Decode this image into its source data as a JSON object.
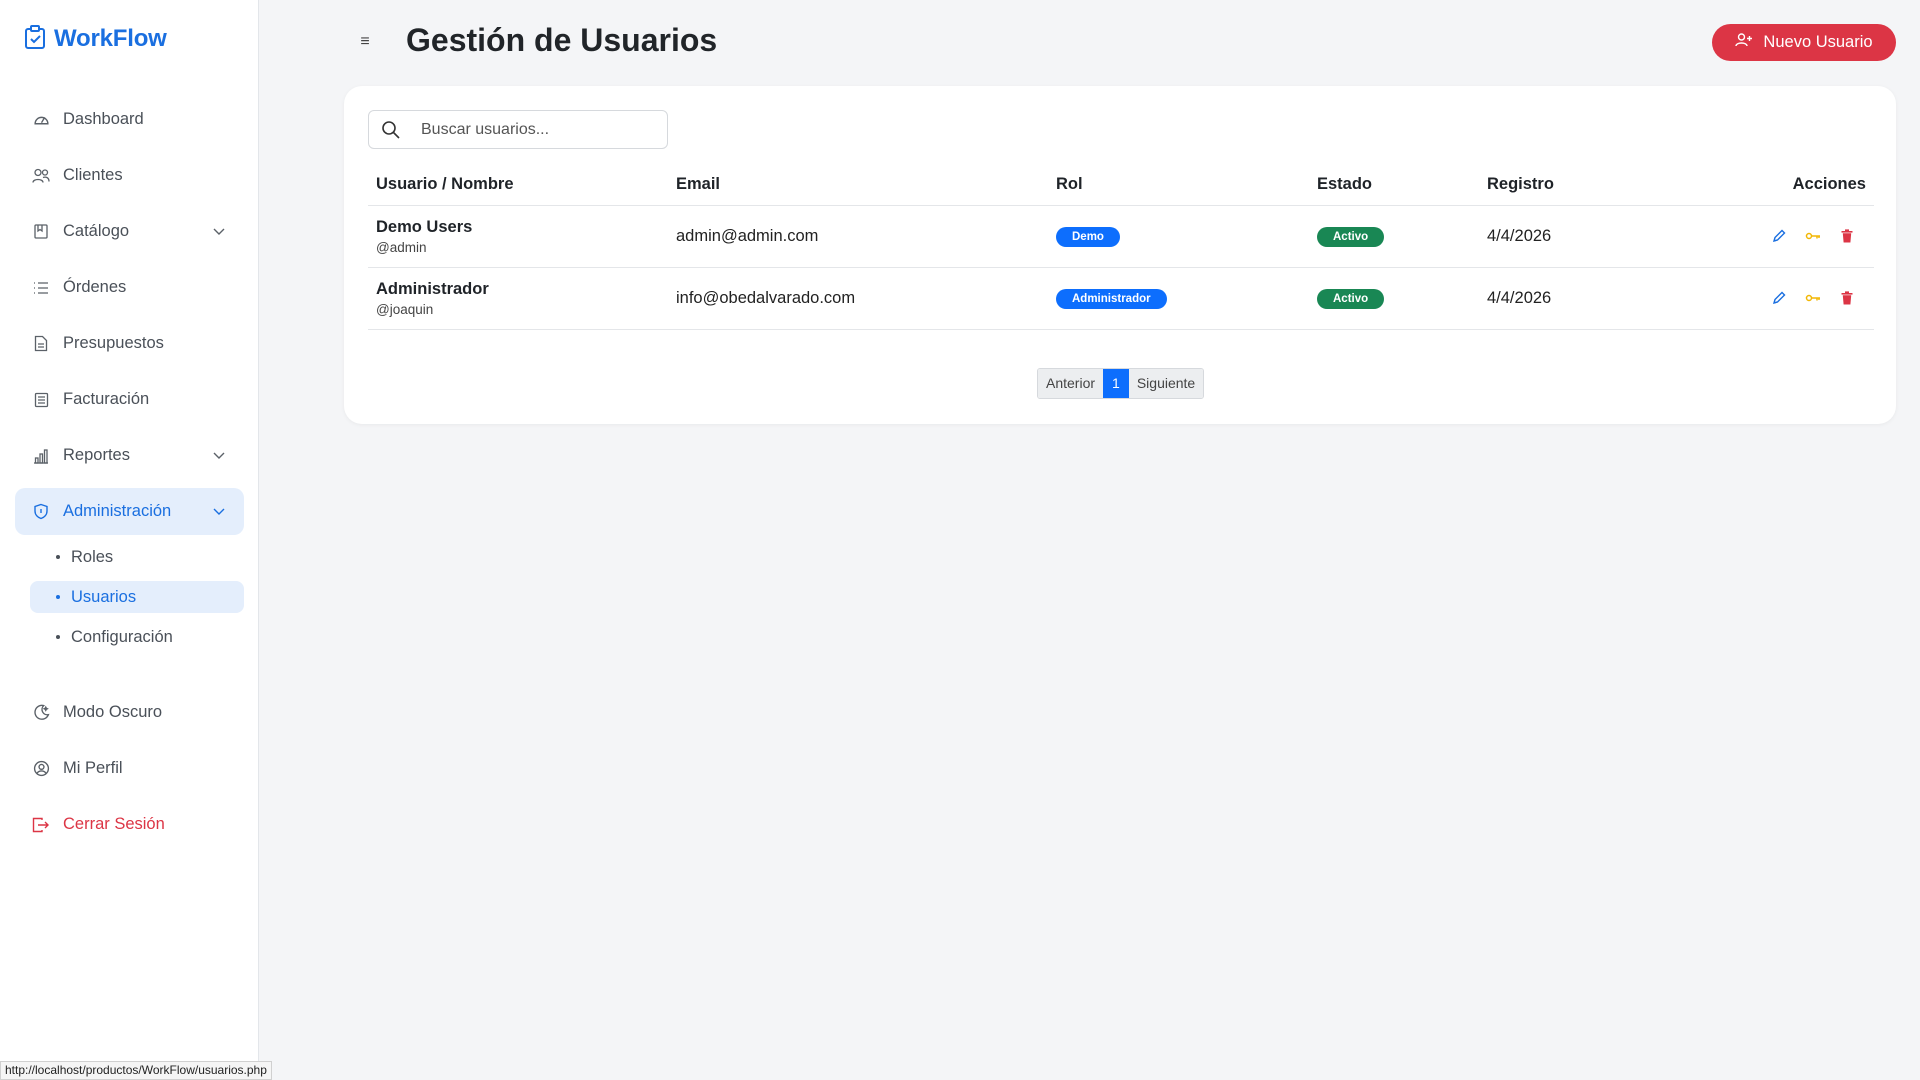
{
  "brand": {
    "name": "WorkFlow",
    "color": "#1a6fe0"
  },
  "nav": {
    "items": [
      {
        "label": "Dashboard",
        "icon": "speedometer-icon"
      },
      {
        "label": "Clientes",
        "icon": "people-icon"
      },
      {
        "label": "Catálogo",
        "icon": "book-icon",
        "expandable": true
      },
      {
        "label": "Órdenes",
        "icon": "list-icon"
      },
      {
        "label": "Presupuestos",
        "icon": "document-icon"
      },
      {
        "label": "Facturación",
        "icon": "receipt-icon"
      },
      {
        "label": "Reportes",
        "icon": "bar-chart-icon",
        "expandable": true
      },
      {
        "label": "Administración",
        "icon": "shield-icon",
        "expandable": true,
        "active": true
      }
    ],
    "sub_items": [
      {
        "label": "Roles"
      },
      {
        "label": "Usuarios",
        "active": true
      },
      {
        "label": "Configuración"
      }
    ],
    "bottom": [
      {
        "label": "Modo Oscuro",
        "icon": "moon-icon"
      },
      {
        "label": "Mi Perfil",
        "icon": "person-circle-icon"
      },
      {
        "label": "Cerrar Sesión",
        "icon": "logout-icon",
        "color": "#dc3545"
      }
    ]
  },
  "header": {
    "title": "Gestión de Usuarios",
    "new_button": "Nuevo Usuario",
    "new_button_color": "#dc3545"
  },
  "search": {
    "placeholder": "Buscar usuarios..."
  },
  "table": {
    "columns": [
      "Usuario / Nombre",
      "Email",
      "Rol",
      "Estado",
      "Registro",
      "Acciones"
    ],
    "rows": [
      {
        "name": "Demo Users",
        "handle": "@admin",
        "email": "admin@admin.com",
        "role": "Demo",
        "state": "Activo",
        "date": "4/4/2026"
      },
      {
        "name": "Administrador",
        "handle": "@joaquin",
        "email": "info@obedalvarado.com",
        "role": "Administrador",
        "state": "Activo",
        "date": "4/4/2026"
      }
    ]
  },
  "pagination": {
    "prev": "Anterior",
    "current": "1",
    "next": "Siguiente"
  },
  "statusbar": {
    "url": "http://localhost/productos/WorkFlow/usuarios.php"
  }
}
